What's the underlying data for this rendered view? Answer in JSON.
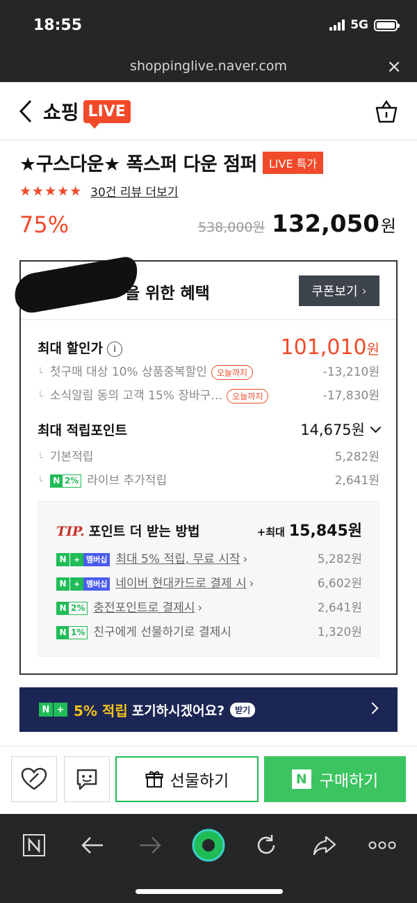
{
  "status_bar": {
    "time": "18:55",
    "network": "5G"
  },
  "browser": {
    "url": "shoppinglive.naver.com"
  },
  "header": {
    "logo_text": "쇼핑",
    "logo_live": "LIVE"
  },
  "product": {
    "title": "★구스다운★ 폭스퍼 다운 점퍼",
    "live_badge": "LIVE 특가",
    "stars": "★★★★★",
    "rating": 4.5,
    "review_link": "30건 리뷰 더보기",
    "discount_pct": "75%",
    "original_price": "538,000원",
    "price": "132,050",
    "price_unit": "원"
  },
  "benefits": {
    "title_suffix": "을 위한 혜택",
    "coupon_button": "쿠폰보기",
    "max_discount_label": "최대 할인가",
    "max_discount_value": "101,010",
    "won": "원",
    "discount_items": [
      {
        "label": "첫구매 대상 10% 상품중복할인",
        "tag": "오늘까지",
        "value": "-13,210원"
      },
      {
        "label": "소식알림 동의 고객 15% 장바구…",
        "tag": "오늘까지",
        "value": "-17,830원"
      }
    ],
    "max_points_label": "최대 적립포인트",
    "max_points_value": "14,675원",
    "point_items": [
      {
        "tag": "",
        "label": "기본적립",
        "value": "5,282원"
      },
      {
        "tag": "2%",
        "label": "라이브 추가적립",
        "value": "2,641원"
      }
    ],
    "tip": {
      "word": "TIP.",
      "title": "포인트 더 받는 방법",
      "max_prefix": "+최대",
      "max_value": "15,845원",
      "items": [
        {
          "tag_type": "membership",
          "tag": "멤버십",
          "label": "최대 5% 적립, 무료 시작",
          "arrow": "›",
          "value": "5,282원"
        },
        {
          "tag_type": "membership",
          "tag": "멤버십",
          "label": "네이버 현대카드로 결제 시",
          "arrow": "›",
          "value": "6,602원"
        },
        {
          "tag_type": "pct",
          "tag": "2%",
          "label": "충전포인트로 결제시",
          "arrow": "›",
          "value": "2,641원"
        },
        {
          "tag_type": "pct",
          "tag": "1%",
          "label": "친구에게 선물하기로 결제시",
          "arrow": "",
          "value": "1,320원"
        }
      ]
    }
  },
  "banner": {
    "highlight": "5% 적립",
    "text": "포기하시겠어요?",
    "badge": "받기"
  },
  "actions": {
    "gift_label": "선물하기",
    "buy_label": "구매하기",
    "buy_logo": "N"
  },
  "colors": {
    "accent_red": "#f04a2a",
    "naver_green": "#1fbc58",
    "buy_green": "#3cc461",
    "banner_navy": "#1b2655"
  }
}
